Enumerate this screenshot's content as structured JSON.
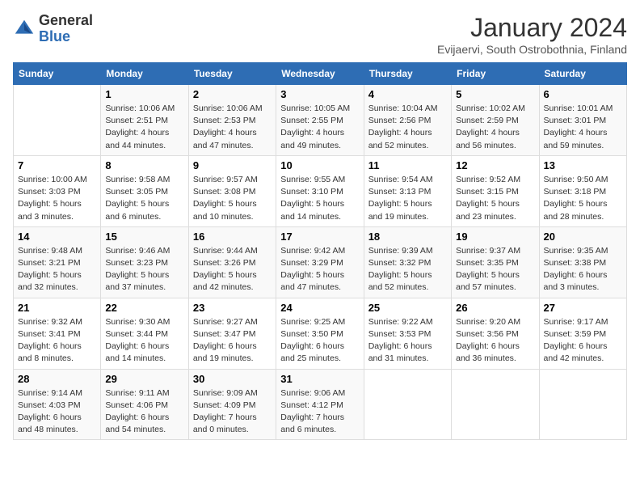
{
  "header": {
    "logo_general": "General",
    "logo_blue": "Blue",
    "month_title": "January 2024",
    "subtitle": "Evijaervi, South Ostrobothnia, Finland"
  },
  "weekdays": [
    "Sunday",
    "Monday",
    "Tuesday",
    "Wednesday",
    "Thursday",
    "Friday",
    "Saturday"
  ],
  "weeks": [
    [
      {
        "day": "",
        "info": ""
      },
      {
        "day": "1",
        "info": "Sunrise: 10:06 AM\nSunset: 2:51 PM\nDaylight: 4 hours\nand 44 minutes."
      },
      {
        "day": "2",
        "info": "Sunrise: 10:06 AM\nSunset: 2:53 PM\nDaylight: 4 hours\nand 47 minutes."
      },
      {
        "day": "3",
        "info": "Sunrise: 10:05 AM\nSunset: 2:55 PM\nDaylight: 4 hours\nand 49 minutes."
      },
      {
        "day": "4",
        "info": "Sunrise: 10:04 AM\nSunset: 2:56 PM\nDaylight: 4 hours\nand 52 minutes."
      },
      {
        "day": "5",
        "info": "Sunrise: 10:02 AM\nSunset: 2:59 PM\nDaylight: 4 hours\nand 56 minutes."
      },
      {
        "day": "6",
        "info": "Sunrise: 10:01 AM\nSunset: 3:01 PM\nDaylight: 4 hours\nand 59 minutes."
      }
    ],
    [
      {
        "day": "7",
        "info": "Sunrise: 10:00 AM\nSunset: 3:03 PM\nDaylight: 5 hours\nand 3 minutes."
      },
      {
        "day": "8",
        "info": "Sunrise: 9:58 AM\nSunset: 3:05 PM\nDaylight: 5 hours\nand 6 minutes."
      },
      {
        "day": "9",
        "info": "Sunrise: 9:57 AM\nSunset: 3:08 PM\nDaylight: 5 hours\nand 10 minutes."
      },
      {
        "day": "10",
        "info": "Sunrise: 9:55 AM\nSunset: 3:10 PM\nDaylight: 5 hours\nand 14 minutes."
      },
      {
        "day": "11",
        "info": "Sunrise: 9:54 AM\nSunset: 3:13 PM\nDaylight: 5 hours\nand 19 minutes."
      },
      {
        "day": "12",
        "info": "Sunrise: 9:52 AM\nSunset: 3:15 PM\nDaylight: 5 hours\nand 23 minutes."
      },
      {
        "day": "13",
        "info": "Sunrise: 9:50 AM\nSunset: 3:18 PM\nDaylight: 5 hours\nand 28 minutes."
      }
    ],
    [
      {
        "day": "14",
        "info": "Sunrise: 9:48 AM\nSunset: 3:21 PM\nDaylight: 5 hours\nand 32 minutes."
      },
      {
        "day": "15",
        "info": "Sunrise: 9:46 AM\nSunset: 3:23 PM\nDaylight: 5 hours\nand 37 minutes."
      },
      {
        "day": "16",
        "info": "Sunrise: 9:44 AM\nSunset: 3:26 PM\nDaylight: 5 hours\nand 42 minutes."
      },
      {
        "day": "17",
        "info": "Sunrise: 9:42 AM\nSunset: 3:29 PM\nDaylight: 5 hours\nand 47 minutes."
      },
      {
        "day": "18",
        "info": "Sunrise: 9:39 AM\nSunset: 3:32 PM\nDaylight: 5 hours\nand 52 minutes."
      },
      {
        "day": "19",
        "info": "Sunrise: 9:37 AM\nSunset: 3:35 PM\nDaylight: 5 hours\nand 57 minutes."
      },
      {
        "day": "20",
        "info": "Sunrise: 9:35 AM\nSunset: 3:38 PM\nDaylight: 6 hours\nand 3 minutes."
      }
    ],
    [
      {
        "day": "21",
        "info": "Sunrise: 9:32 AM\nSunset: 3:41 PM\nDaylight: 6 hours\nand 8 minutes."
      },
      {
        "day": "22",
        "info": "Sunrise: 9:30 AM\nSunset: 3:44 PM\nDaylight: 6 hours\nand 14 minutes."
      },
      {
        "day": "23",
        "info": "Sunrise: 9:27 AM\nSunset: 3:47 PM\nDaylight: 6 hours\nand 19 minutes."
      },
      {
        "day": "24",
        "info": "Sunrise: 9:25 AM\nSunset: 3:50 PM\nDaylight: 6 hours\nand 25 minutes."
      },
      {
        "day": "25",
        "info": "Sunrise: 9:22 AM\nSunset: 3:53 PM\nDaylight: 6 hours\nand 31 minutes."
      },
      {
        "day": "26",
        "info": "Sunrise: 9:20 AM\nSunset: 3:56 PM\nDaylight: 6 hours\nand 36 minutes."
      },
      {
        "day": "27",
        "info": "Sunrise: 9:17 AM\nSunset: 3:59 PM\nDaylight: 6 hours\nand 42 minutes."
      }
    ],
    [
      {
        "day": "28",
        "info": "Sunrise: 9:14 AM\nSunset: 4:03 PM\nDaylight: 6 hours\nand 48 minutes."
      },
      {
        "day": "29",
        "info": "Sunrise: 9:11 AM\nSunset: 4:06 PM\nDaylight: 6 hours\nand 54 minutes."
      },
      {
        "day": "30",
        "info": "Sunrise: 9:09 AM\nSunset: 4:09 PM\nDaylight: 7 hours\nand 0 minutes."
      },
      {
        "day": "31",
        "info": "Sunrise: 9:06 AM\nSunset: 4:12 PM\nDaylight: 7 hours\nand 6 minutes."
      },
      {
        "day": "",
        "info": ""
      },
      {
        "day": "",
        "info": ""
      },
      {
        "day": "",
        "info": ""
      }
    ]
  ]
}
